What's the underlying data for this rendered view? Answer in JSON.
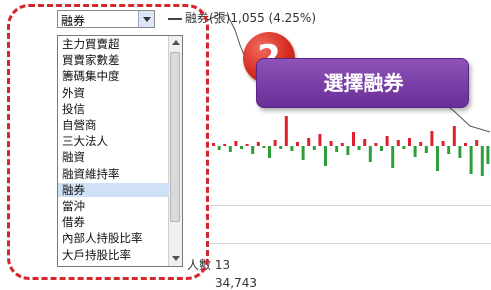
{
  "selector": {
    "value": "融券"
  },
  "list": {
    "items": [
      "主力買賣超",
      "買賣家數差",
      "籌碼集中度",
      "外資",
      "投信",
      "自營商",
      "三大法人",
      "融資",
      "融資維持率",
      "融券",
      "當沖",
      "借券",
      "內部人持股比率",
      "大戶持股比率"
    ],
    "selected": "融券"
  },
  "chart": {
    "series_label": "融券(張)1,055 (4.25%)",
    "bottom_label_1": "人數 13",
    "bottom_label_2": "34,743",
    "colors": {
      "up": "#e0202a",
      "down": "#2e9e3a",
      "line": "#555555"
    }
  },
  "annotation": {
    "step": "2",
    "text": "選擇融券",
    "accent": "#7b3fa8",
    "marker": "#d52b1e"
  }
}
